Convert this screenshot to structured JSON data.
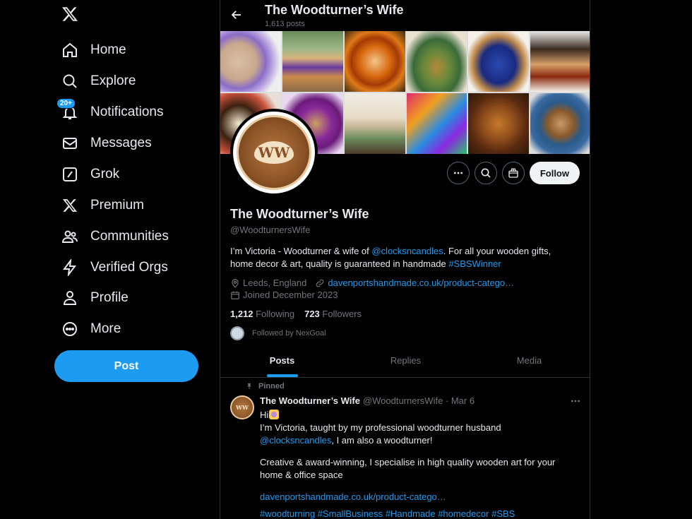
{
  "nav": {
    "items": [
      {
        "label": "Home",
        "icon": "home-icon"
      },
      {
        "label": "Explore",
        "icon": "search-icon"
      },
      {
        "label": "Notifications",
        "icon": "bell-icon",
        "badge": "20+"
      },
      {
        "label": "Messages",
        "icon": "envelope-icon"
      },
      {
        "label": "Grok",
        "icon": "grok-icon"
      },
      {
        "label": "Premium",
        "icon": "x-logo-icon"
      },
      {
        "label": "Communities",
        "icon": "people-icon"
      },
      {
        "label": "Verified Orgs",
        "icon": "lightning-icon"
      },
      {
        "label": "Profile",
        "icon": "person-icon"
      },
      {
        "label": "More",
        "icon": "more-circle-icon"
      }
    ],
    "post_label": "Post"
  },
  "header": {
    "title": "The Woodturner’s Wife",
    "post_count": "1,613 posts"
  },
  "profile": {
    "name": "The Woodturner’s Wife",
    "handle": "@WoodturnersWife",
    "bio_part1": "I’m Victoria - Woodturner & wife of ",
    "bio_mention": "@clocksncandles",
    "bio_part2": ". For all your wooden gifts, home decor & art, quality is guaranteed in handmade ",
    "bio_hashtag": "#SBSWinner",
    "location": "Leeds, England",
    "website": "davenportshandmade.co.uk/product-catego…",
    "joined": "Joined December 2023",
    "following_count": "1,212",
    "following_label": "Following",
    "followers_count": "723",
    "followers_label": "Followers",
    "followed_by": "Followed by NexGoal",
    "follow_label": "Follow"
  },
  "tabs": [
    "Posts",
    "Replies",
    "Media"
  ],
  "tweet": {
    "pinned_label": "Pinned",
    "name": "The Woodturner’s Wife",
    "handle_date": "@WoodturnersWife · Mar 6",
    "line1": "Hi",
    "line2": "I’m Victoria, taught by my professional woodturner husband",
    "mention": "@clocksncandles",
    "line3": ", I am also a woodturner!",
    "line4": "Creative & award-winning, I specialise in high quality wooden art for your home & office space",
    "link": "davenportshandmade.co.uk/product-catego…",
    "hashtags": "#woodturning #SmallBusiness #Handmade #homedecor #SBS"
  },
  "colors": {
    "accent": "#1d9bf0",
    "muted": "#71767b",
    "text": "#e7e9ea",
    "border": "#2f3336"
  }
}
